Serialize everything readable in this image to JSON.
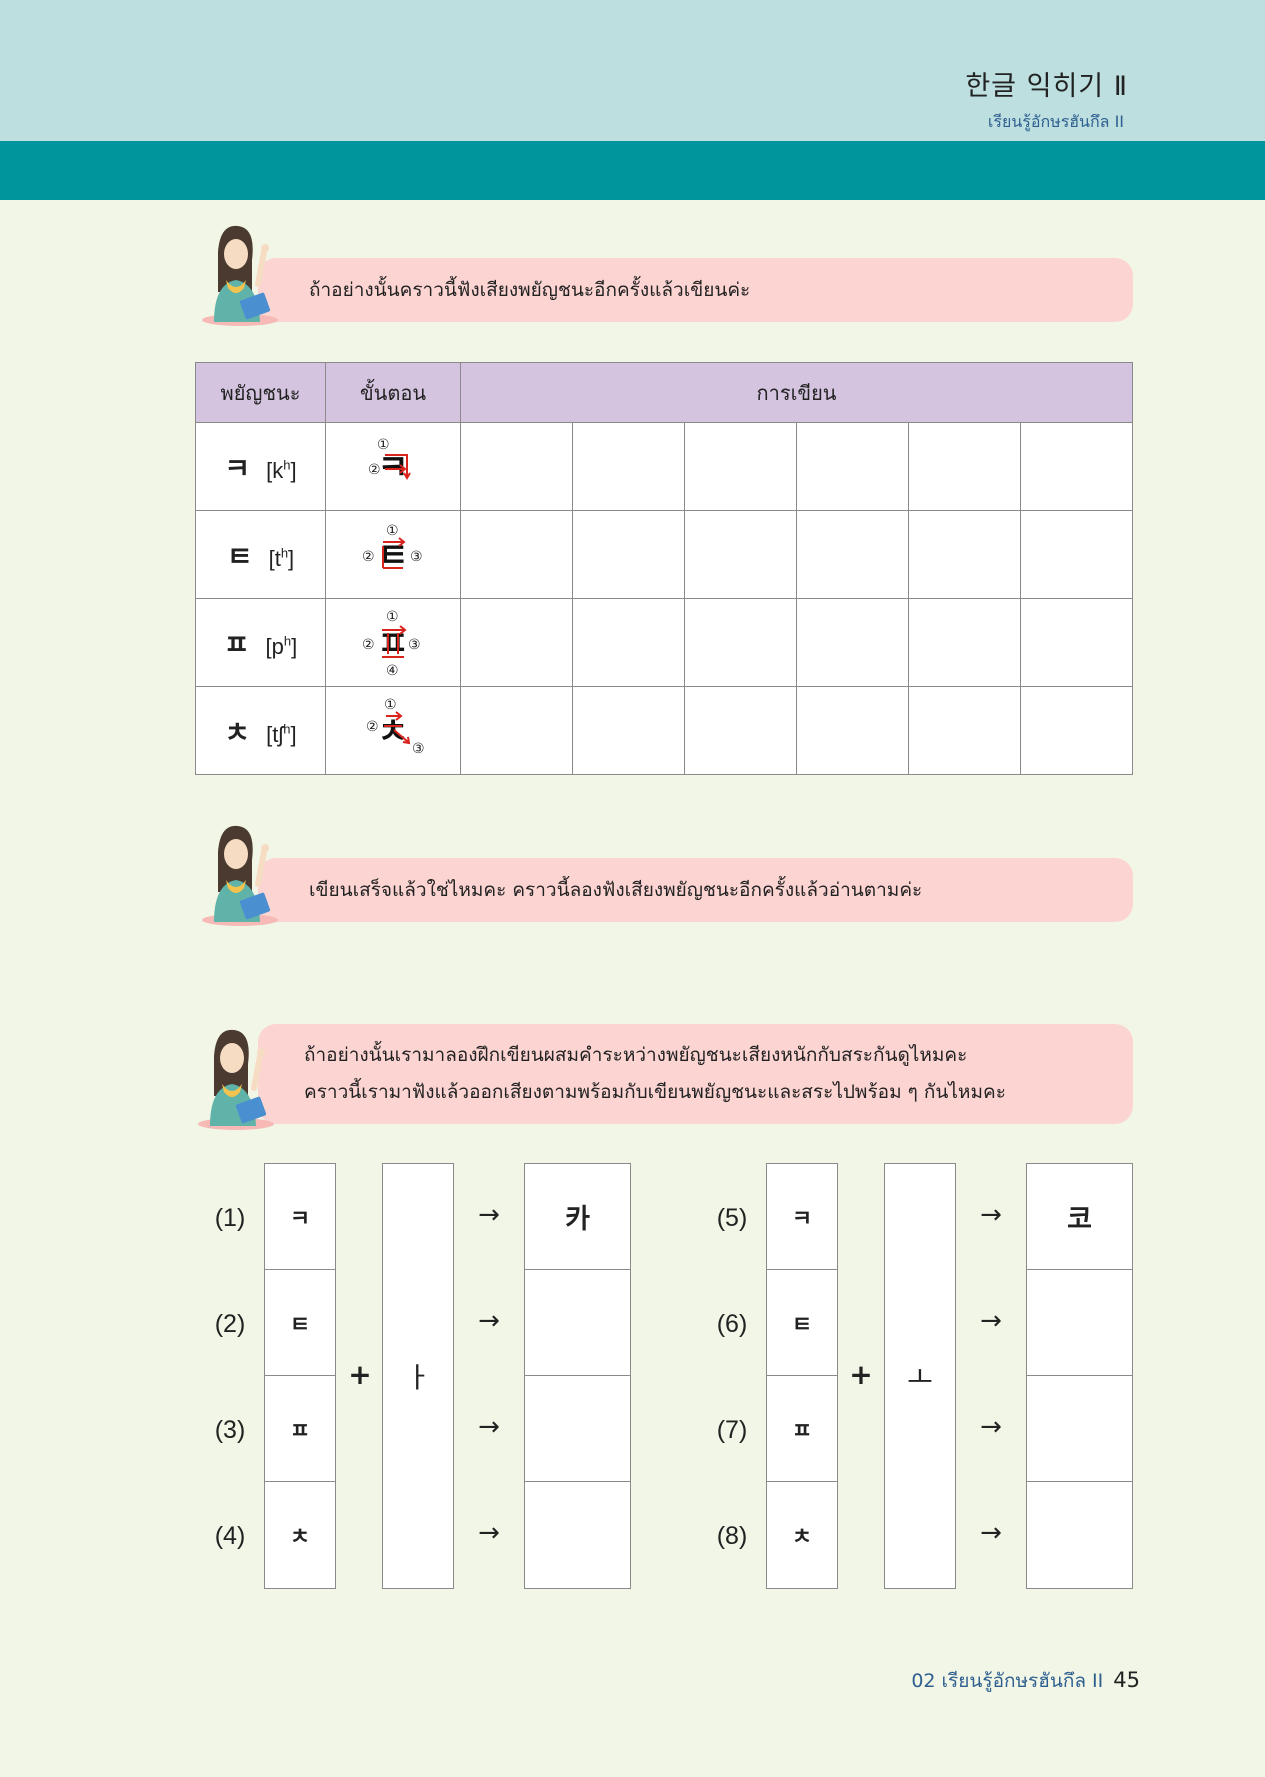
{
  "header": {
    "title_ko": "한글 익히기 Ⅱ",
    "title_th": "เรียนรู้อักษรฮันกึล II"
  },
  "instructions": [
    {
      "lines": [
        "ถ้าอย่างนั้นคราวนี้ฟังเสียงพยัญชนะอีกครั้งแล้วเขียนค่ะ"
      ]
    },
    {
      "lines": [
        "เขียนเสร็จแล้วใช่ไหมคะ คราวนี้ลองฟังเสียงพยัญชนะอีกครั้งแล้วอ่านตามค่ะ"
      ]
    },
    {
      "lines": [
        "ถ้าอย่างนั้นเรามาลองฝึกเขียนผสมคำระหว่างพยัญชนะเสียงหนักกับสระกันดูไหมคะ",
        "คราวนี้เรามาฟังแล้วออกเสียงตามพร้อมกับเขียนพยัญชนะและสระไปพร้อม ๆ กันไหมคะ"
      ]
    }
  ],
  "writing_table": {
    "headers": [
      "พยัญชนะ",
      "ขั้นตอน",
      "การเขียน"
    ],
    "rows": [
      {
        "consonant": "ㅋ",
        "ipa_base": "[k",
        "ipa_sup": "h",
        "ipa_end": "]",
        "stroke_glyph": "ㅋ",
        "stroke_nums": [
          "①",
          "②"
        ]
      },
      {
        "consonant": "ㅌ",
        "ipa_base": "[t",
        "ipa_sup": "h",
        "ipa_end": "]",
        "stroke_glyph": "ㅌ",
        "stroke_nums": [
          "①",
          "②",
          "③"
        ]
      },
      {
        "consonant": "ㅍ",
        "ipa_base": "[p",
        "ipa_sup": "h",
        "ipa_end": "]",
        "stroke_glyph": "ㅍ",
        "stroke_nums": [
          "①",
          "②",
          "③",
          "④"
        ]
      },
      {
        "consonant": "ㅊ",
        "ipa_base": "[tʃ",
        "ipa_sup": "h",
        "ipa_end": "]",
        "stroke_glyph": "ㅊ",
        "stroke_nums": [
          "①",
          "②",
          "③"
        ]
      }
    ]
  },
  "combination": {
    "plus": "+",
    "arrow": "→",
    "groups": [
      {
        "labels": [
          "(1)",
          "(2)",
          "(3)",
          "(4)"
        ],
        "consonants": [
          "ㅋ",
          "ㅌ",
          "ㅍ",
          "ㅊ"
        ],
        "vowel": "ㅏ",
        "results": [
          "카",
          "",
          "",
          ""
        ]
      },
      {
        "labels": [
          "(5)",
          "(6)",
          "(7)",
          "(8)"
        ],
        "consonants": [
          "ㅋ",
          "ㅌ",
          "ㅍ",
          "ㅊ"
        ],
        "vowel": "ㅗ",
        "results": [
          "코",
          "",
          "",
          ""
        ]
      }
    ]
  },
  "footer": {
    "chapter": "02 เรียนรู้อักษรฮันกึล II",
    "page": "45"
  },
  "colors": {
    "top_band": "#bddfe0",
    "teal_band": "#00959d",
    "page_bg": "#f1f6e6",
    "bubble": "#fcd5d3",
    "table_header": "#d4c4e0",
    "stroke_arrow": "#d9231d"
  }
}
